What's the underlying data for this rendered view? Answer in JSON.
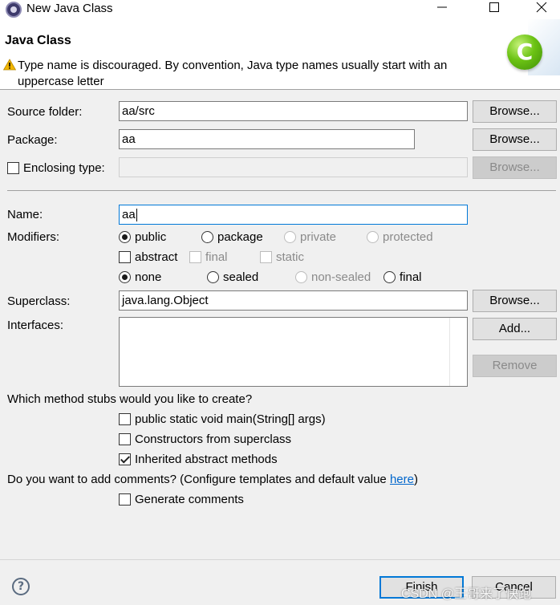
{
  "window": {
    "title": "New Java Class",
    "minimize_icon": "minimize-icon",
    "maximize_icon": "maximize-icon",
    "close_icon": "close-icon"
  },
  "header": {
    "title": "Java Class",
    "warning_line1": "Type name is discouraged. By convention, Java type names usually start with an",
    "warning_line2": "uppercase letter",
    "badge_letter": "C",
    "badge_color": "#6cc314"
  },
  "form": {
    "source_folder_label": "Source folder:",
    "source_folder_value": "aa/src",
    "package_label": "Package:",
    "package_value": "aa",
    "enclosing_type_label": "Enclosing type:",
    "enclosing_type_value": "",
    "browse_label": "Browse...",
    "name_label": "Name:",
    "name_value": "aa",
    "modifiers_label": "Modifiers:",
    "modifiers": {
      "public": "public",
      "package": "package",
      "private": "private",
      "protected": "protected",
      "abstract": "abstract",
      "final": "final",
      "static": "static",
      "none": "none",
      "sealed": "sealed",
      "non_sealed": "non-sealed",
      "final2": "final"
    },
    "superclass_label": "Superclass:",
    "superclass_value": "java.lang.Object",
    "interfaces_label": "Interfaces:",
    "add_label": "Add...",
    "remove_label": "Remove"
  },
  "stubs": {
    "question": "Which method stubs would you like to create?",
    "main": "public static void main(String[] args)",
    "constructors": "Constructors from superclass",
    "inherited": "Inherited abstract methods"
  },
  "comments": {
    "question_prefix": "Do you want to add comments? (Configure templates and default value ",
    "link": "here",
    "question_suffix": ")",
    "generate": "Generate comments"
  },
  "footer": {
    "finish": "Finish",
    "cancel": "Cancel",
    "help_icon": "help-icon",
    "watermark": "CSDN @王哥来了快跑"
  },
  "colors": {
    "focus": "#0078d7",
    "link": "#0066cc",
    "warning": "#f2b600"
  }
}
